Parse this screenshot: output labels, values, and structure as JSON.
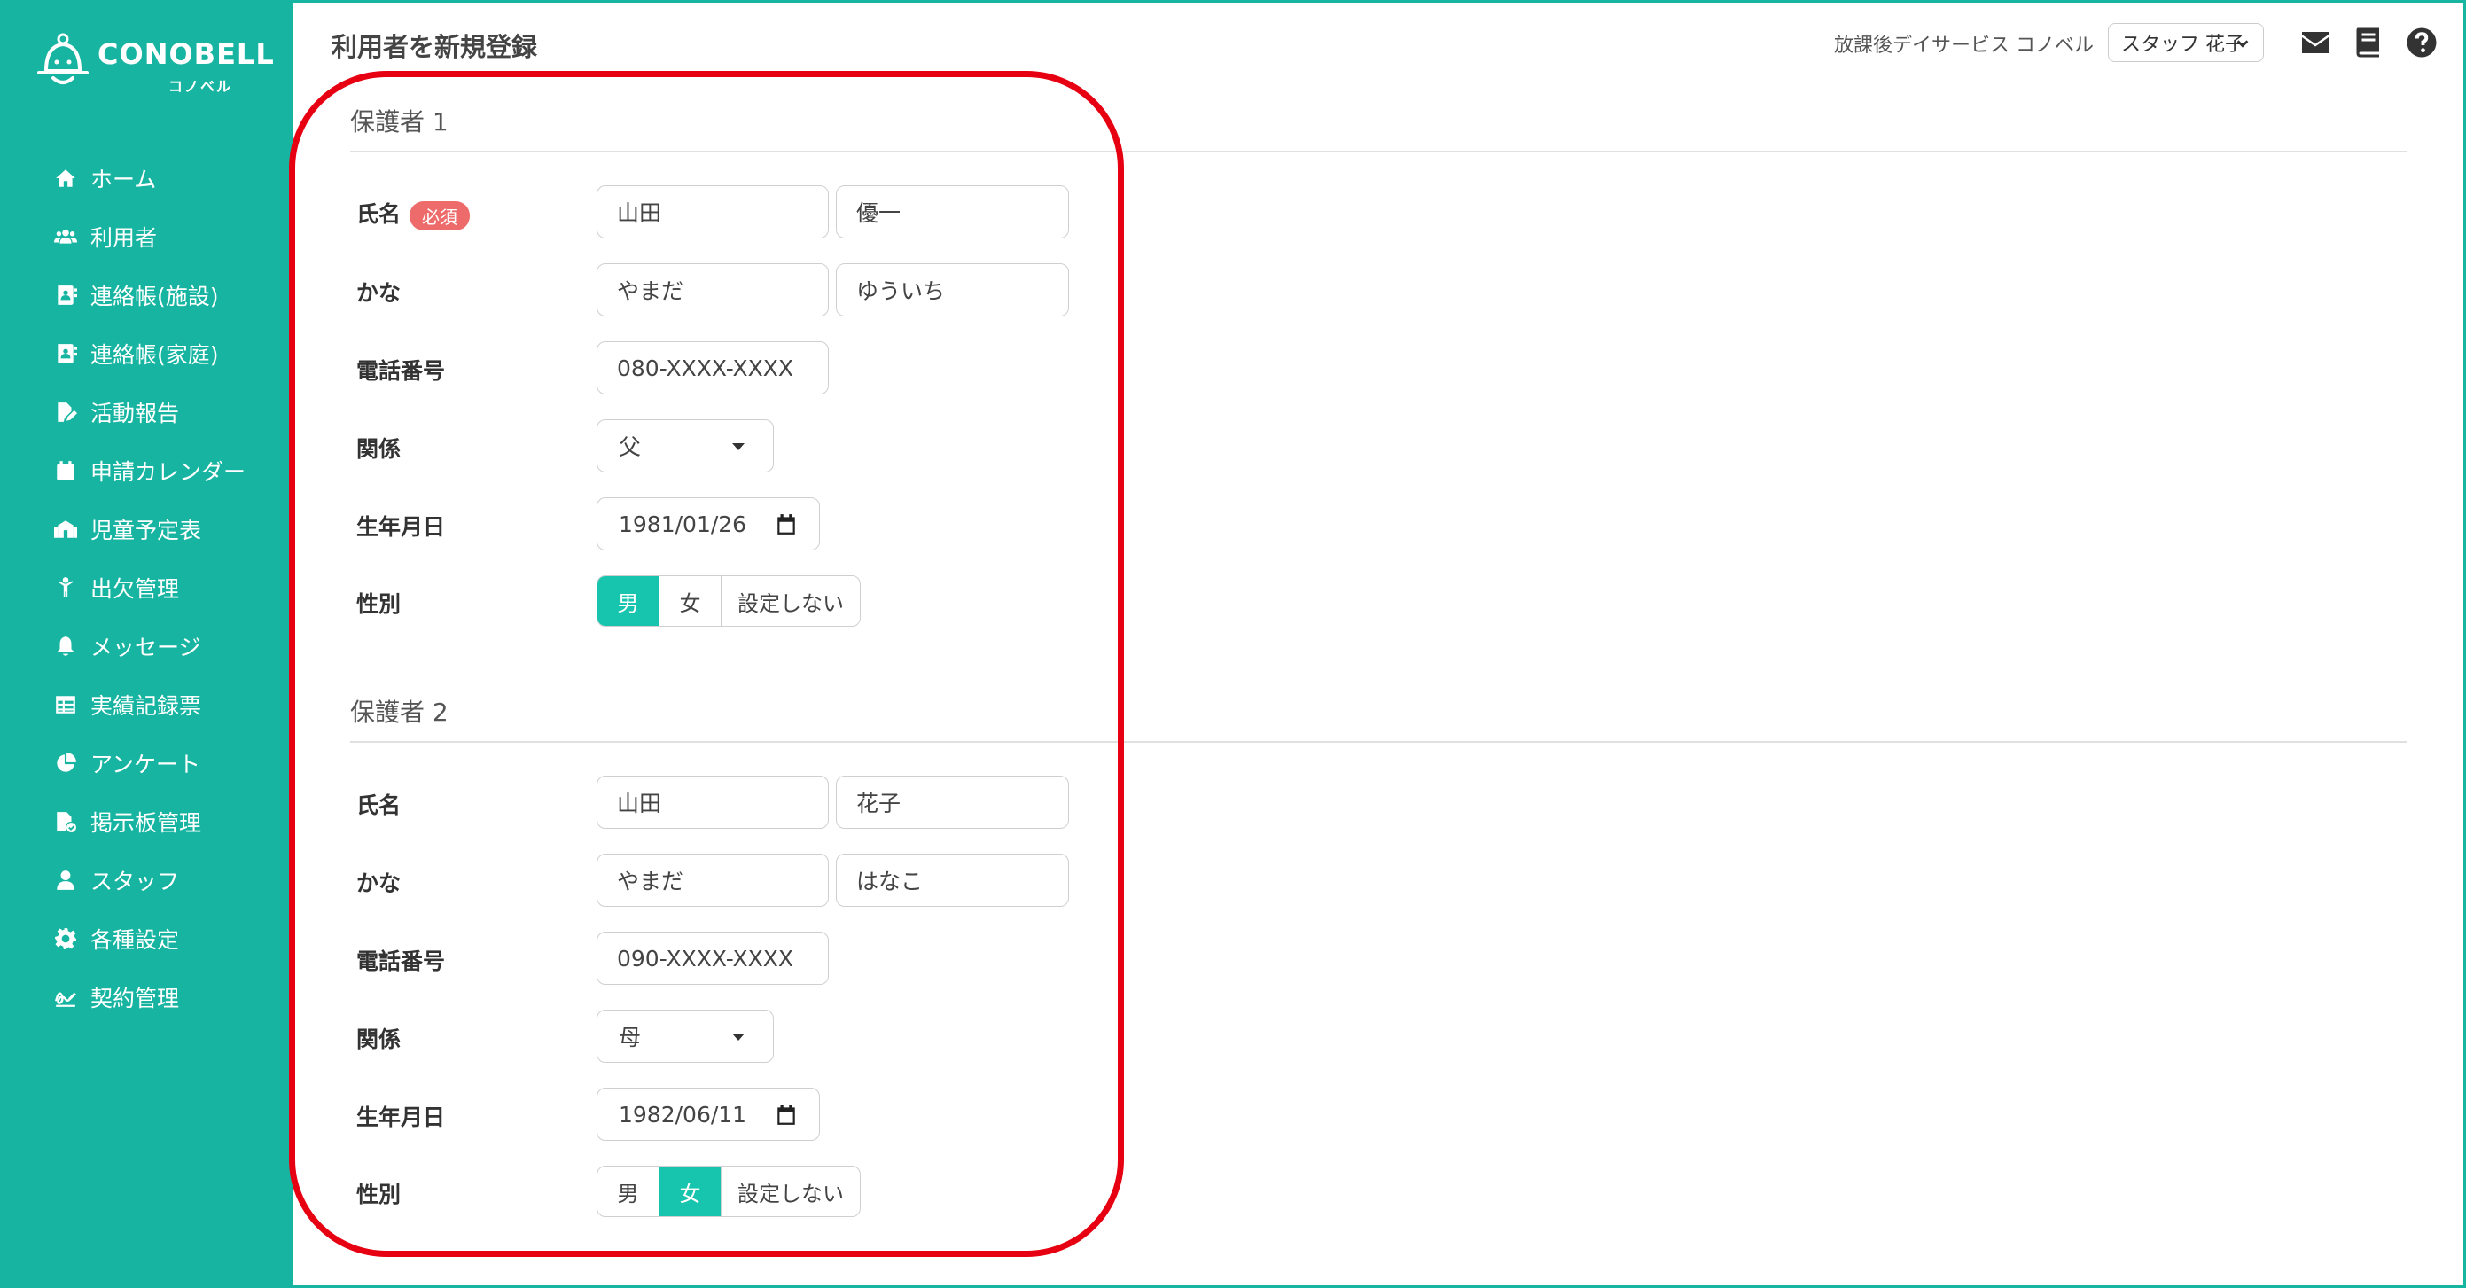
{
  "brand": {
    "name": "CONOBELL",
    "sub": "コノベル"
  },
  "header": {
    "title": "利用者を新規登録",
    "facility": "放課後デイサービス コノベル",
    "staff": "スタッフ 花子"
  },
  "sidebar": {
    "items": [
      {
        "label": "ホーム",
        "icon": "home-icon"
      },
      {
        "label": "利用者",
        "icon": "users-icon"
      },
      {
        "label": "連絡帳(施設)",
        "icon": "contact-book-icon"
      },
      {
        "label": "連絡帳(家庭)",
        "icon": "contact-book-icon"
      },
      {
        "label": "活動報告",
        "icon": "file-edit-icon"
      },
      {
        "label": "申請カレンダー",
        "icon": "calendar-icon"
      },
      {
        "label": "児童予定表",
        "icon": "school-icon"
      },
      {
        "label": "出欠管理",
        "icon": "child-icon"
      },
      {
        "label": "メッセージ",
        "icon": "bell-icon"
      },
      {
        "label": "実績記録票",
        "icon": "table-icon"
      },
      {
        "label": "アンケート",
        "icon": "pie-chart-icon"
      },
      {
        "label": "掲示板管理",
        "icon": "file-check-icon"
      },
      {
        "label": "スタッフ",
        "icon": "user-tie-icon"
      },
      {
        "label": "各種設定",
        "icon": "gear-icon"
      },
      {
        "label": "契約管理",
        "icon": "signature-icon"
      }
    ]
  },
  "labels": {
    "name": "氏名",
    "required": "必須",
    "kana": "かな",
    "phone": "電話番号",
    "relation": "関係",
    "birthdate": "生年月日",
    "gender": "性別"
  },
  "gender_options": [
    "男",
    "女",
    "設定しない"
  ],
  "guardians": [
    {
      "title": "保護者 1",
      "last_name": "山田",
      "first_name": "優一",
      "last_kana": "やまだ",
      "first_kana": "ゆういち",
      "phone": "080-XXXX-XXXX",
      "relation": "父",
      "birthdate": "1981/01/26",
      "gender": "男"
    },
    {
      "title": "保護者 2",
      "last_name": "山田",
      "first_name": "花子",
      "last_kana": "やまだ",
      "first_kana": "はなこ",
      "phone": "090-XXXX-XXXX",
      "relation": "母",
      "birthdate": "1982/06/11",
      "gender": "女"
    }
  ],
  "colors": {
    "sidebar": "#17b5a1",
    "active_segment": "#17c4ae",
    "required_badge": "#ee6b6b",
    "highlight": "#e60012"
  }
}
